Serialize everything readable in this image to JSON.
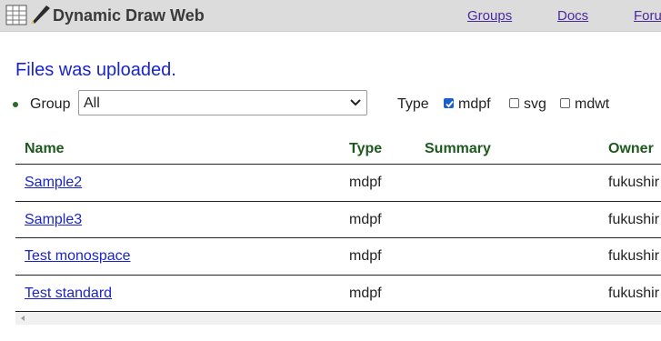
{
  "header": {
    "brand": "Dynamic Draw Web",
    "nav": [
      {
        "label": "Groups"
      },
      {
        "label": "Docs"
      },
      {
        "label": "Foru"
      }
    ]
  },
  "status_message": "Files was uploaded.",
  "filters": {
    "group_label": "Group",
    "group_select": {
      "selected": "All"
    },
    "type_label": "Type",
    "types": [
      {
        "label": "mdpf",
        "checked": true
      },
      {
        "label": "svg",
        "checked": false
      },
      {
        "label": "mdwt",
        "checked": false
      }
    ]
  },
  "table": {
    "headers": [
      "Name",
      "Type",
      "Summary",
      "Owner"
    ],
    "rows": [
      {
        "name": "Sample2",
        "type": "mdpf",
        "summary": "",
        "owner": "fukushir"
      },
      {
        "name": "Sample3",
        "type": "mdpf",
        "summary": "",
        "owner": "fukushir"
      },
      {
        "name": "Test monospace",
        "type": "mdpf",
        "summary": "",
        "owner": "fukushir"
      },
      {
        "name": "Test standard",
        "type": "mdpf",
        "summary": "",
        "owner": "fukushir"
      }
    ]
  },
  "colors": {
    "header_bg": "#dcdcdc",
    "status_text": "#1a24cc",
    "table_header_text": "#1e5a1e",
    "link": "#1a24cc",
    "checkbox_checked": "#1a5fd0"
  }
}
